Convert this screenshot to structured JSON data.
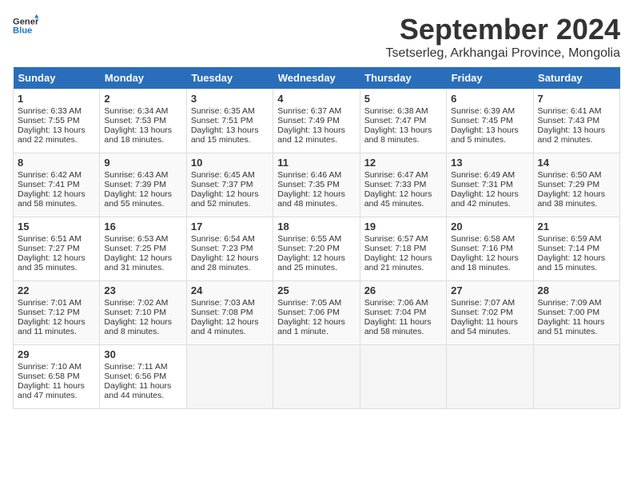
{
  "header": {
    "logo_line1": "General",
    "logo_line2": "Blue",
    "month": "September 2024",
    "location": "Tsetserleg, Arkhangai Province, Mongolia"
  },
  "days_of_week": [
    "Sunday",
    "Monday",
    "Tuesday",
    "Wednesday",
    "Thursday",
    "Friday",
    "Saturday"
  ],
  "weeks": [
    [
      {
        "day": "1",
        "lines": [
          "Sunrise: 6:33 AM",
          "Sunset: 7:55 PM",
          "Daylight: 13 hours",
          "and 22 minutes."
        ]
      },
      {
        "day": "2",
        "lines": [
          "Sunrise: 6:34 AM",
          "Sunset: 7:53 PM",
          "Daylight: 13 hours",
          "and 18 minutes."
        ]
      },
      {
        "day": "3",
        "lines": [
          "Sunrise: 6:35 AM",
          "Sunset: 7:51 PM",
          "Daylight: 13 hours",
          "and 15 minutes."
        ]
      },
      {
        "day": "4",
        "lines": [
          "Sunrise: 6:37 AM",
          "Sunset: 7:49 PM",
          "Daylight: 13 hours",
          "and 12 minutes."
        ]
      },
      {
        "day": "5",
        "lines": [
          "Sunrise: 6:38 AM",
          "Sunset: 7:47 PM",
          "Daylight: 13 hours",
          "and 8 minutes."
        ]
      },
      {
        "day": "6",
        "lines": [
          "Sunrise: 6:39 AM",
          "Sunset: 7:45 PM",
          "Daylight: 13 hours",
          "and 5 minutes."
        ]
      },
      {
        "day": "7",
        "lines": [
          "Sunrise: 6:41 AM",
          "Sunset: 7:43 PM",
          "Daylight: 13 hours",
          "and 2 minutes."
        ]
      }
    ],
    [
      {
        "day": "8",
        "lines": [
          "Sunrise: 6:42 AM",
          "Sunset: 7:41 PM",
          "Daylight: 12 hours",
          "and 58 minutes."
        ]
      },
      {
        "day": "9",
        "lines": [
          "Sunrise: 6:43 AM",
          "Sunset: 7:39 PM",
          "Daylight: 12 hours",
          "and 55 minutes."
        ]
      },
      {
        "day": "10",
        "lines": [
          "Sunrise: 6:45 AM",
          "Sunset: 7:37 PM",
          "Daylight: 12 hours",
          "and 52 minutes."
        ]
      },
      {
        "day": "11",
        "lines": [
          "Sunrise: 6:46 AM",
          "Sunset: 7:35 PM",
          "Daylight: 12 hours",
          "and 48 minutes."
        ]
      },
      {
        "day": "12",
        "lines": [
          "Sunrise: 6:47 AM",
          "Sunset: 7:33 PM",
          "Daylight: 12 hours",
          "and 45 minutes."
        ]
      },
      {
        "day": "13",
        "lines": [
          "Sunrise: 6:49 AM",
          "Sunset: 7:31 PM",
          "Daylight: 12 hours",
          "and 42 minutes."
        ]
      },
      {
        "day": "14",
        "lines": [
          "Sunrise: 6:50 AM",
          "Sunset: 7:29 PM",
          "Daylight: 12 hours",
          "and 38 minutes."
        ]
      }
    ],
    [
      {
        "day": "15",
        "lines": [
          "Sunrise: 6:51 AM",
          "Sunset: 7:27 PM",
          "Daylight: 12 hours",
          "and 35 minutes."
        ]
      },
      {
        "day": "16",
        "lines": [
          "Sunrise: 6:53 AM",
          "Sunset: 7:25 PM",
          "Daylight: 12 hours",
          "and 31 minutes."
        ]
      },
      {
        "day": "17",
        "lines": [
          "Sunrise: 6:54 AM",
          "Sunset: 7:23 PM",
          "Daylight: 12 hours",
          "and 28 minutes."
        ]
      },
      {
        "day": "18",
        "lines": [
          "Sunrise: 6:55 AM",
          "Sunset: 7:20 PM",
          "Daylight: 12 hours",
          "and 25 minutes."
        ]
      },
      {
        "day": "19",
        "lines": [
          "Sunrise: 6:57 AM",
          "Sunset: 7:18 PM",
          "Daylight: 12 hours",
          "and 21 minutes."
        ]
      },
      {
        "day": "20",
        "lines": [
          "Sunrise: 6:58 AM",
          "Sunset: 7:16 PM",
          "Daylight: 12 hours",
          "and 18 minutes."
        ]
      },
      {
        "day": "21",
        "lines": [
          "Sunrise: 6:59 AM",
          "Sunset: 7:14 PM",
          "Daylight: 12 hours",
          "and 15 minutes."
        ]
      }
    ],
    [
      {
        "day": "22",
        "lines": [
          "Sunrise: 7:01 AM",
          "Sunset: 7:12 PM",
          "Daylight: 12 hours",
          "and 11 minutes."
        ]
      },
      {
        "day": "23",
        "lines": [
          "Sunrise: 7:02 AM",
          "Sunset: 7:10 PM",
          "Daylight: 12 hours",
          "and 8 minutes."
        ]
      },
      {
        "day": "24",
        "lines": [
          "Sunrise: 7:03 AM",
          "Sunset: 7:08 PM",
          "Daylight: 12 hours",
          "and 4 minutes."
        ]
      },
      {
        "day": "25",
        "lines": [
          "Sunrise: 7:05 AM",
          "Sunset: 7:06 PM",
          "Daylight: 12 hours",
          "and 1 minute."
        ]
      },
      {
        "day": "26",
        "lines": [
          "Sunrise: 7:06 AM",
          "Sunset: 7:04 PM",
          "Daylight: 11 hours",
          "and 58 minutes."
        ]
      },
      {
        "day": "27",
        "lines": [
          "Sunrise: 7:07 AM",
          "Sunset: 7:02 PM",
          "Daylight: 11 hours",
          "and 54 minutes."
        ]
      },
      {
        "day": "28",
        "lines": [
          "Sunrise: 7:09 AM",
          "Sunset: 7:00 PM",
          "Daylight: 11 hours",
          "and 51 minutes."
        ]
      }
    ],
    [
      {
        "day": "29",
        "lines": [
          "Sunrise: 7:10 AM",
          "Sunset: 6:58 PM",
          "Daylight: 11 hours",
          "and 47 minutes."
        ]
      },
      {
        "day": "30",
        "lines": [
          "Sunrise: 7:11 AM",
          "Sunset: 6:56 PM",
          "Daylight: 11 hours",
          "and 44 minutes."
        ]
      },
      null,
      null,
      null,
      null,
      null
    ]
  ]
}
